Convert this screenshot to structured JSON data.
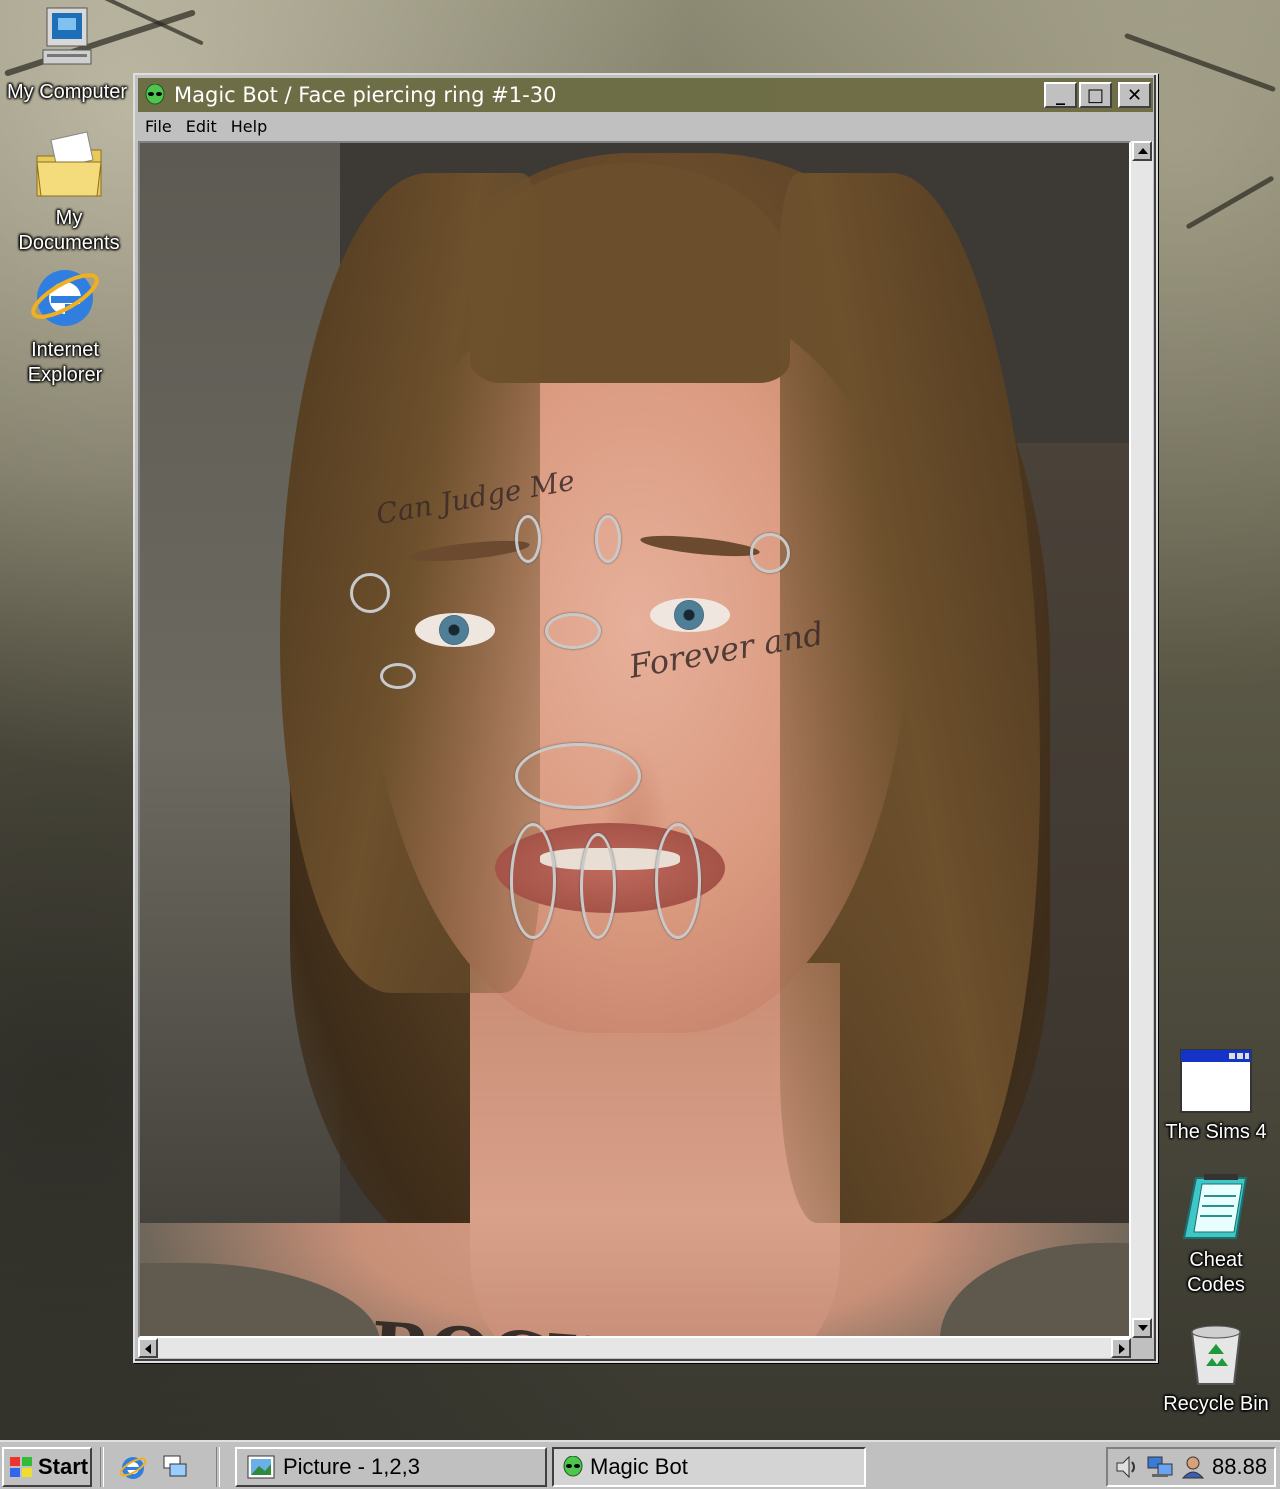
{
  "desktop": {
    "left_icons": [
      {
        "label": "My Computer",
        "icon": "computer-icon"
      },
      {
        "label": "My Documents",
        "icon": "folder-icon"
      },
      {
        "label_line1": "Internet",
        "label_line2": "Explorer",
        "icon": "internet-explorer-icon"
      }
    ],
    "right_icons": [
      {
        "label": "The Sims 4",
        "icon": "program-window-icon"
      },
      {
        "label_line1": "Cheat",
        "label_line2": "Codes",
        "icon": "notepad-icon"
      },
      {
        "label": "Recycle Bin",
        "icon": "recycle-bin-icon"
      }
    ]
  },
  "window": {
    "title": "Magic Bot / Face piercing ring #1-30",
    "icon": "alien-icon",
    "buttons": {
      "minimize": "_",
      "maximize": "□",
      "close": "✕"
    },
    "menu": [
      "File",
      "Edit",
      "Help"
    ],
    "image": {
      "tattoo_forehead": "Can Judge Me",
      "tattoo_cheek": "Forever and",
      "tattoo_chest": "ROCKNROLL"
    }
  },
  "taskbar": {
    "start_label": "Start",
    "quick_launch": [
      "internet-explorer-icon",
      "show-desktop-icon"
    ],
    "tasks": [
      {
        "label": "Picture - 1,2,3",
        "icon": "picture-icon",
        "active": false
      },
      {
        "label": "Magic Bot",
        "icon": "alien-icon",
        "active": true
      }
    ],
    "tray": {
      "icons": [
        "volume-icon",
        "network-icon",
        "user-icon"
      ],
      "clock": "88.88"
    }
  },
  "colors": {
    "titlebar": "#6e6e46",
    "window_face": "#c0c0c0"
  }
}
